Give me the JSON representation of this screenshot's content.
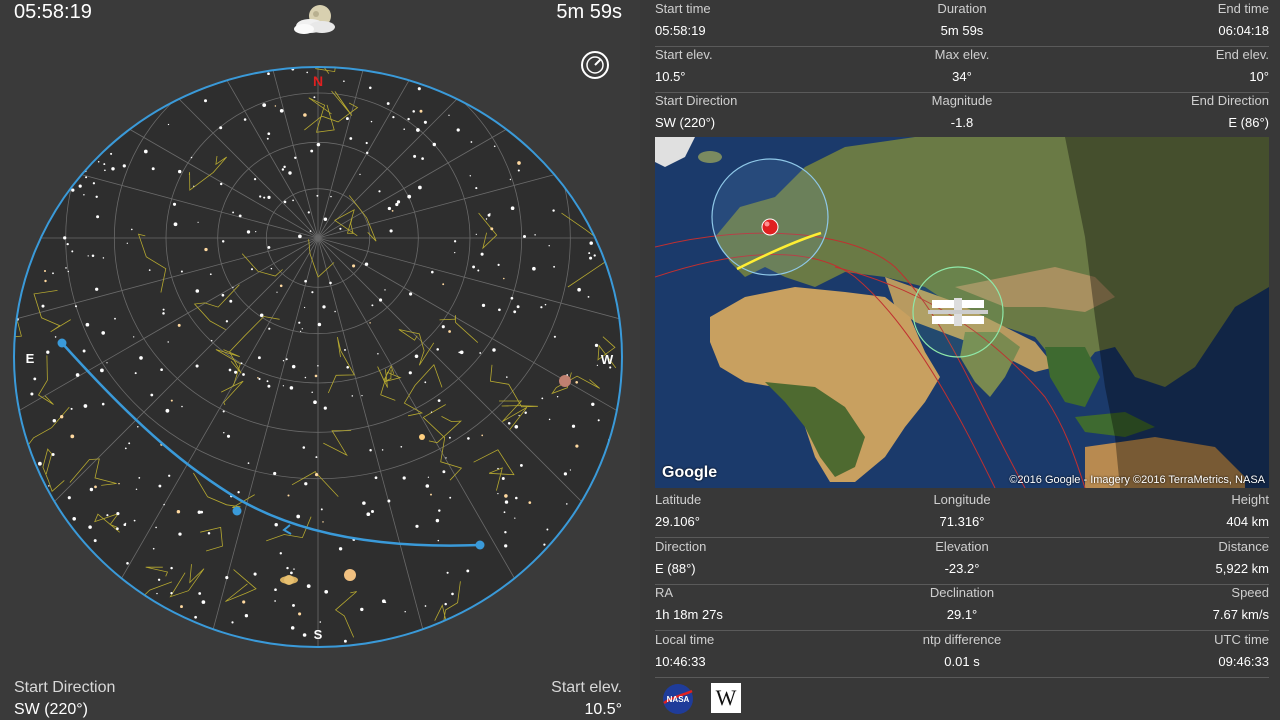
{
  "left_panel": {
    "current_time": "05:58:19",
    "duration": "5m 59s",
    "weather_icon": "partly-cloudy-night-icon",
    "clock_icon": "compass-clock-icon",
    "compass": {
      "north": "N",
      "south": "S",
      "east": "E",
      "west": "W"
    },
    "start_direction_label": "Start Direction",
    "start_direction_value": "SW (220°)",
    "start_elev_label": "Start elev.",
    "start_elev_value": "10.5°"
  },
  "pass_info": [
    {
      "labels": [
        "Start time",
        "Duration",
        "End time"
      ],
      "values": [
        "05:58:19",
        "5m 59s",
        "06:04:18"
      ]
    },
    {
      "labels": [
        "Start elev.",
        "Max elev.",
        "End elev."
      ],
      "values": [
        "10.5°",
        "34°",
        "10°"
      ]
    },
    {
      "labels": [
        "Start Direction",
        "Magnitude",
        "End Direction"
      ],
      "values": [
        "SW (220°)",
        "-1.8",
        "E (86°)"
      ]
    }
  ],
  "map": {
    "logo": "Google",
    "attribution": "©2016 Google - Imagery ©2016 TerraMetrics, NASA"
  },
  "position_info": [
    {
      "labels": [
        "Latitude",
        "Longitude",
        "Height"
      ],
      "values": [
        "29.106°",
        "71.316°",
        "404 km"
      ]
    },
    {
      "labels": [
        "Direction",
        "Elevation",
        "Distance"
      ],
      "values": [
        "E (88°)",
        "-23.2°",
        "5,922 km"
      ]
    },
    {
      "labels": [
        "RA",
        "Declination",
        "Speed"
      ],
      "values": [
        "1h 18m 27s",
        "29.1°",
        "7.67 km/s"
      ]
    },
    {
      "labels": [
        "Local time",
        "ntp difference",
        "UTC time"
      ],
      "values": [
        "10:46:33",
        "0.01 s",
        "09:46:33"
      ]
    }
  ],
  "footer": {
    "nasa_icon": "nasa-logo-icon",
    "wiki_label": "W"
  },
  "colors": {
    "background": "#3a3a3a",
    "horizon": "#3a9ad9",
    "pass_path": "#3a9ad9",
    "constellation": "#c8b832",
    "north_marker": "#e02020",
    "ground_track": "#ffee33"
  }
}
